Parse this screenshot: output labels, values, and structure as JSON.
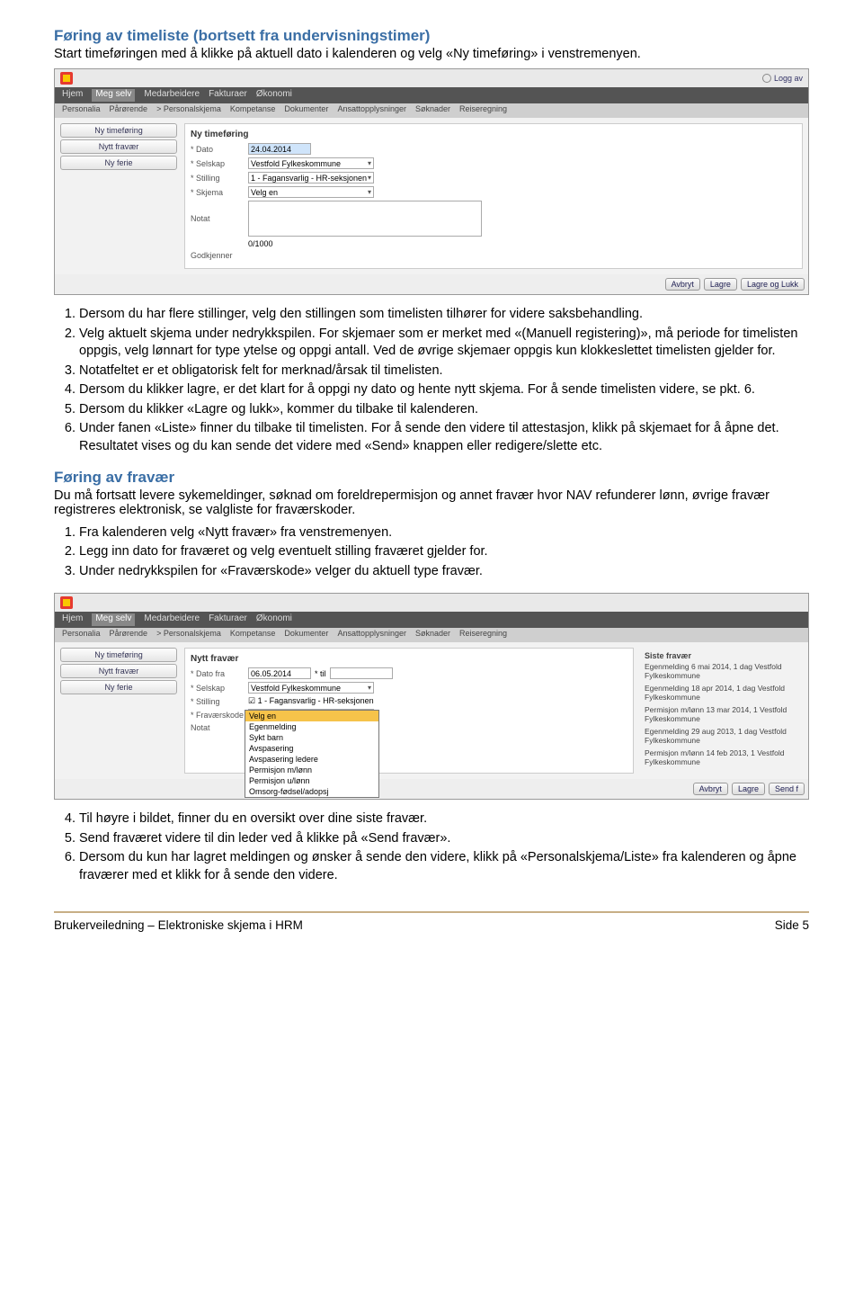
{
  "section1": {
    "heading": "Føring av timeliste (bortsett fra undervisningstimer)",
    "intro": "Start timeføringen med å klikke på aktuell dato i kalenderen og velg «Ny timeføring» i venstremenyen.",
    "steps": [
      "Dersom du har flere stillinger, velg den stillingen som timelisten tilhører for videre saksbehandling.",
      "Velg aktuelt skjema under nedrykkspilen. For skjemaer som er merket med «(Manuell registering)», må periode for timelisten oppgis, velg lønnart for type ytelse og oppgi antall. Ved de øvrige skjemaer oppgis kun klokkeslettet timelisten gjelder for.",
      "Notatfeltet er et obligatorisk felt for merknad/årsak til timelisten.",
      "Dersom du klikker lagre, er det klart for å oppgi ny dato og hente nytt skjema. For å sende timelisten videre, se pkt. 6.",
      "Dersom du klikker «Lagre og lukk», kommer du tilbake til kalenderen.",
      "Under fanen «Liste» finner du tilbake til timelisten. For å sende den videre til attestasjon, klikk på skjemaet for å åpne det. Resultatet vises og du kan sende det videre med «Send» knappen eller redigere/slette etc."
    ]
  },
  "section2": {
    "heading": "Føring av fravær",
    "intro": "Du må fortsatt levere sykemeldinger, søknad om foreldrepermisjon og annet fravær hvor NAV refunderer lønn, øvrige fravær registreres elektronisk, se valgliste for fraværskoder.",
    "steps_a": [
      "Fra kalenderen velg «Nytt fravær» fra venstremenyen.",
      "Legg inn dato for fraværet og velg eventuelt stilling fraværet gjelder for.",
      "Under nedrykkspilen for «Fraværskode» velger du aktuell type fravær."
    ],
    "steps_b": [
      "Til høyre i bildet, finner du en oversikt over dine siste fravær.",
      "Send fraværet videre til din leder ved å klikke på «Send fravær».",
      "Dersom du kun har lagret meldingen og ønsker å sende den videre, klikk på «Personalskjema/Liste» fra kalenderen og åpne fraværer med et klikk for å sende den videre."
    ]
  },
  "ss1": {
    "logg_av": "Logg av",
    "nav": [
      "Hjem",
      "Meg selv",
      "Medarbeidere",
      "Fakturaer",
      "Økonomi"
    ],
    "subnav": [
      "Personalia",
      "Pårørende",
      "> Personalskjema",
      "Kompetanse",
      "Dokumenter",
      "Ansattopplysninger",
      "Søknader",
      "Reiseregning"
    ],
    "side": [
      "Ny timeføring",
      "Nytt fravær",
      "Ny ferie"
    ],
    "form_title": "Ny timeføring",
    "labels": {
      "dato": "* Dato",
      "selskap": "* Selskap",
      "stilling": "* Stilling",
      "skjema": "* Skjema",
      "notat": "Notat",
      "godkjenner": "Godkjenner"
    },
    "values": {
      "dato": "24.04.2014",
      "selskap": "Vestfold Fylkeskommune",
      "stilling": "1 - Fagansvarlig - HR-seksjonen",
      "skjema": "Velg en",
      "counter": "0/1000"
    },
    "buttons": {
      "avbryt": "Avbryt",
      "lagre": "Lagre",
      "lagre_lukk": "Lagre og Lukk"
    }
  },
  "ss2": {
    "nav": [
      "Hjem",
      "Meg selv",
      "Medarbeidere",
      "Fakturaer",
      "Økonomi"
    ],
    "subnav": [
      "Personalia",
      "Pårørende",
      "> Personalskjema",
      "Kompetanse",
      "Dokumenter",
      "Ansattopplysninger",
      "Søknader",
      "Reiseregning"
    ],
    "side": [
      "Ny timeføring",
      "Nytt fravær",
      "Ny ferie"
    ],
    "form_title": "Nytt fravær",
    "labels": {
      "dato": "* Dato fra",
      "til": "* til",
      "selskap": "* Selskap",
      "stilling": "* Stilling",
      "kode": "* Fraværskode",
      "notat": "Notat"
    },
    "values": {
      "dato": "06.05.2014",
      "selskap": "Vestfold Fylkeskommune",
      "stilling": "☑ 1 - Fagansvarlig - HR-seksjonen"
    },
    "dropdown": [
      "Velg en",
      "Egenmelding",
      "Sykt barn",
      "Avspasering",
      "Avspasering ledere",
      "Permisjon m/lønn",
      "Permisjon u/lønn",
      "Omsorg-fødsel/adopsj"
    ],
    "right_title": "Siste fravær",
    "right_items": [
      "Egenmelding 6 mai 2014, 1 dag Vestfold Fylkeskommune",
      "Egenmelding 18 apr 2014, 1 dag Vestfold Fylkeskommune",
      "Permisjon m/lønn 13 mar 2014, 1 Vestfold Fylkeskommune",
      "Egenmelding 29 aug 2013, 1 dag Vestfold Fylkeskommune",
      "Permisjon m/lønn 14 feb 2013, 1 Vestfold Fylkeskommune"
    ],
    "buttons": {
      "avbryt": "Avbryt",
      "lagre": "Lagre",
      "send": "Send f"
    }
  },
  "footer": {
    "left": "Brukerveiledning – Elektroniske skjema i HRM",
    "right": "Side 5"
  }
}
